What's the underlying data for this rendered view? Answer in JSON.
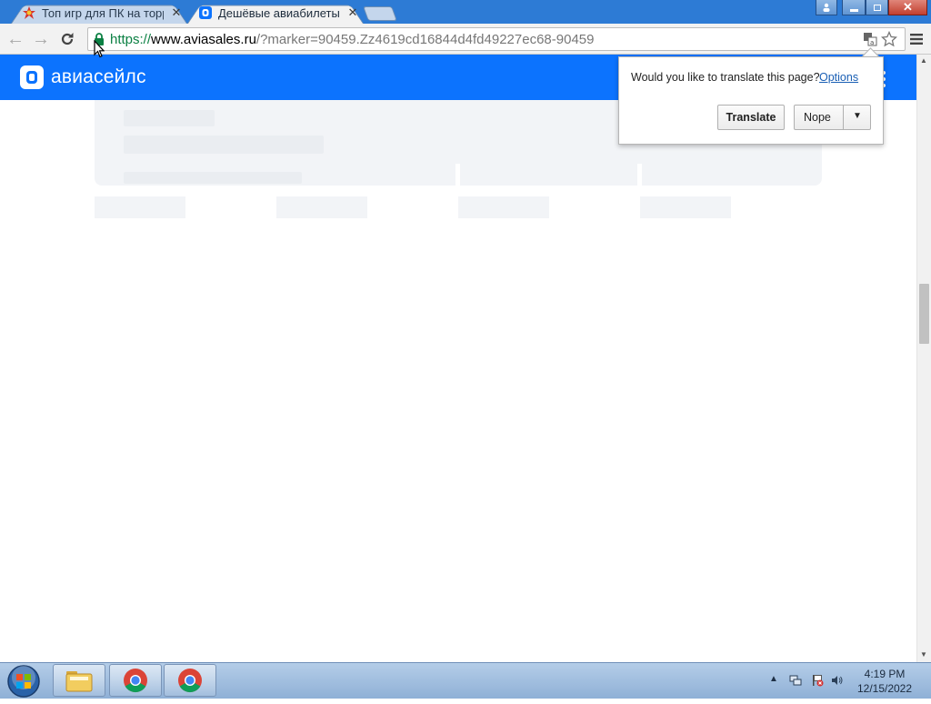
{
  "browser": {
    "tabs": [
      {
        "title": "Топ игр для ПК на торре",
        "active": false
      },
      {
        "title": "Дешёвые авиабилеты он",
        "active": true
      }
    ],
    "url": {
      "scheme": "https://",
      "host": "www.aviasales.ru",
      "path": "/?marker=90459.Zz4619cd16844d4fd49227ec68-90459"
    },
    "colors": {
      "titlebar": "#2d7bd5",
      "brand": "#0c73fe",
      "secure": "#0b8043"
    }
  },
  "site": {
    "logo_text": "авиасейлс"
  },
  "translate_bubble": {
    "question": "Would you like to translate this page?",
    "options_link": "Options",
    "translate_button": "Translate",
    "nope_button": "Nope"
  },
  "taskbar": {
    "items": [
      "windows-explorer",
      "google-chrome",
      "google-chrome"
    ],
    "clock_time": "4:19 PM",
    "clock_date": "12/15/2022"
  }
}
